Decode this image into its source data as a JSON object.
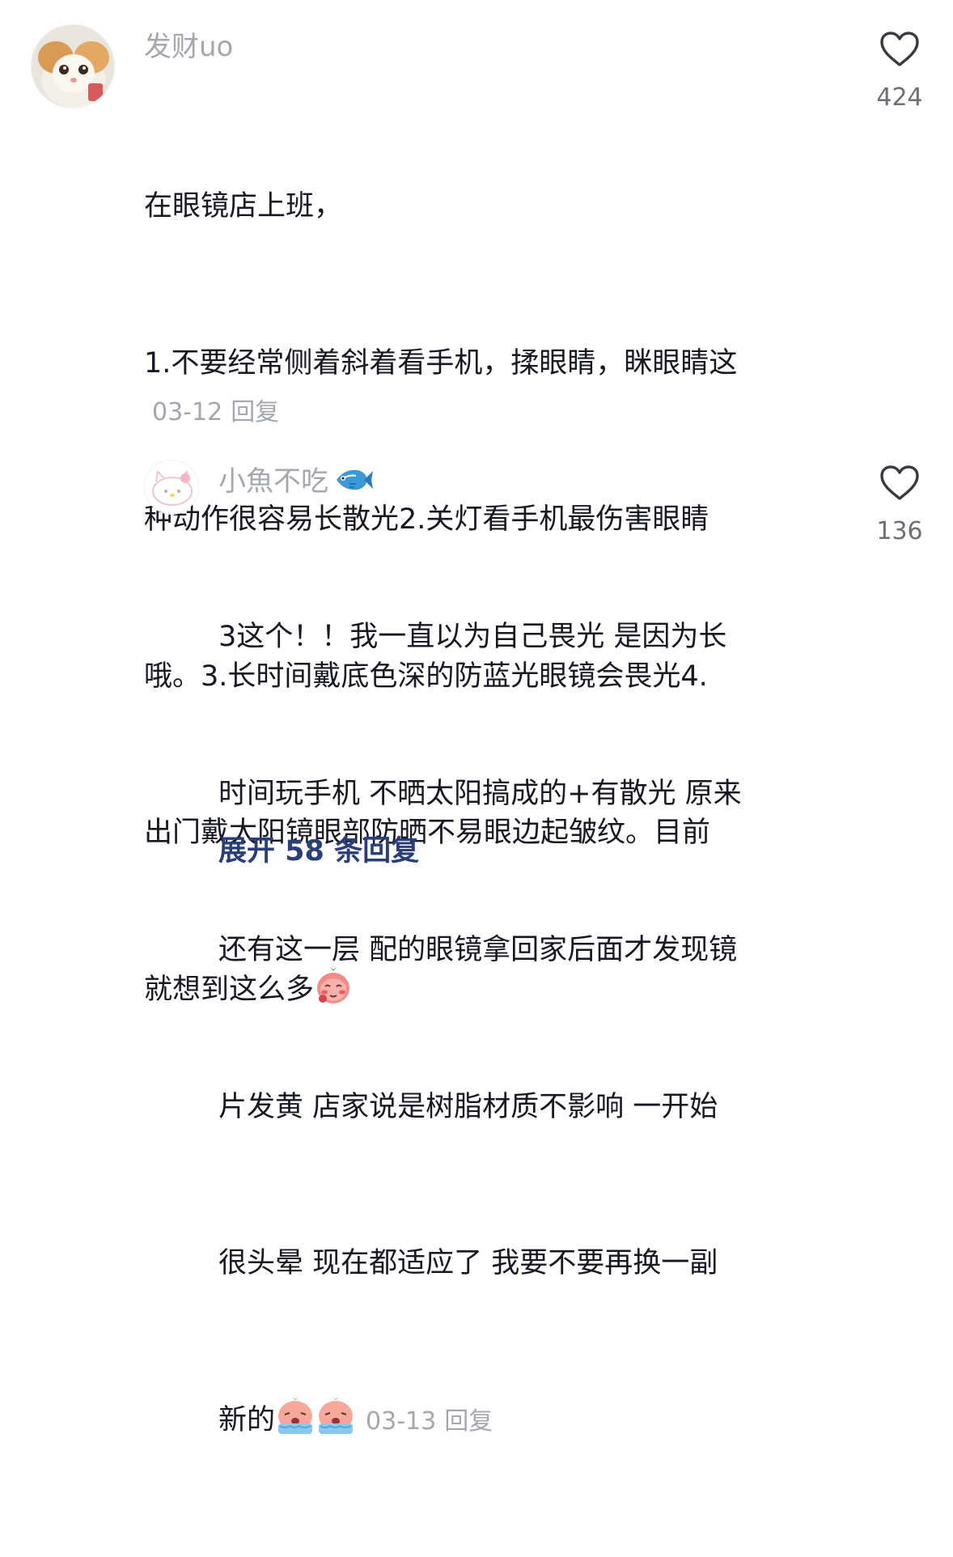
{
  "comments": [
    {
      "username": "发财uo",
      "text_lines": [
        "在眼镜店上班，",
        "1.不要经常侧着斜着看手机，揉眼睛，眯眼睛这",
        "种动作很容易长散光2.关灯看手机最伤害眼睛",
        "哦。3.长时间戴底色深的防蓝光眼镜会畏光4.",
        "出门戴太阳镜眼部防晒不易眼边起皱纹。目前",
        "就想到这么多"
      ],
      "date": "03-12",
      "reply_label": "回复",
      "like_count": "424",
      "emoji": "strawberry-face-emoji"
    },
    {
      "username": "小魚不吃",
      "username_emoji": "fish-emoji",
      "text_lines": [
        "3这个！！我一直以为自己畏光 是因为长",
        "时间玩手机 不晒太阳搞成的+有散光 原来",
        "还有这一层 配的眼镜拿回家后面才发现镜",
        "片发黄 店家说是树脂材质不影响 一开始",
        "很头晕 现在都适应了 我要不要再换一副",
        "新的"
      ],
      "date": "03-13",
      "reply_label": "回复",
      "like_count": "136",
      "emoji": "crying-face-emoji"
    }
  ],
  "expand_label": "展开 58 条回复",
  "colors": {
    "text": "#161823",
    "muted": "#a4a7ad",
    "like_count": "#6c6f76",
    "expand": "#2a3f78"
  }
}
